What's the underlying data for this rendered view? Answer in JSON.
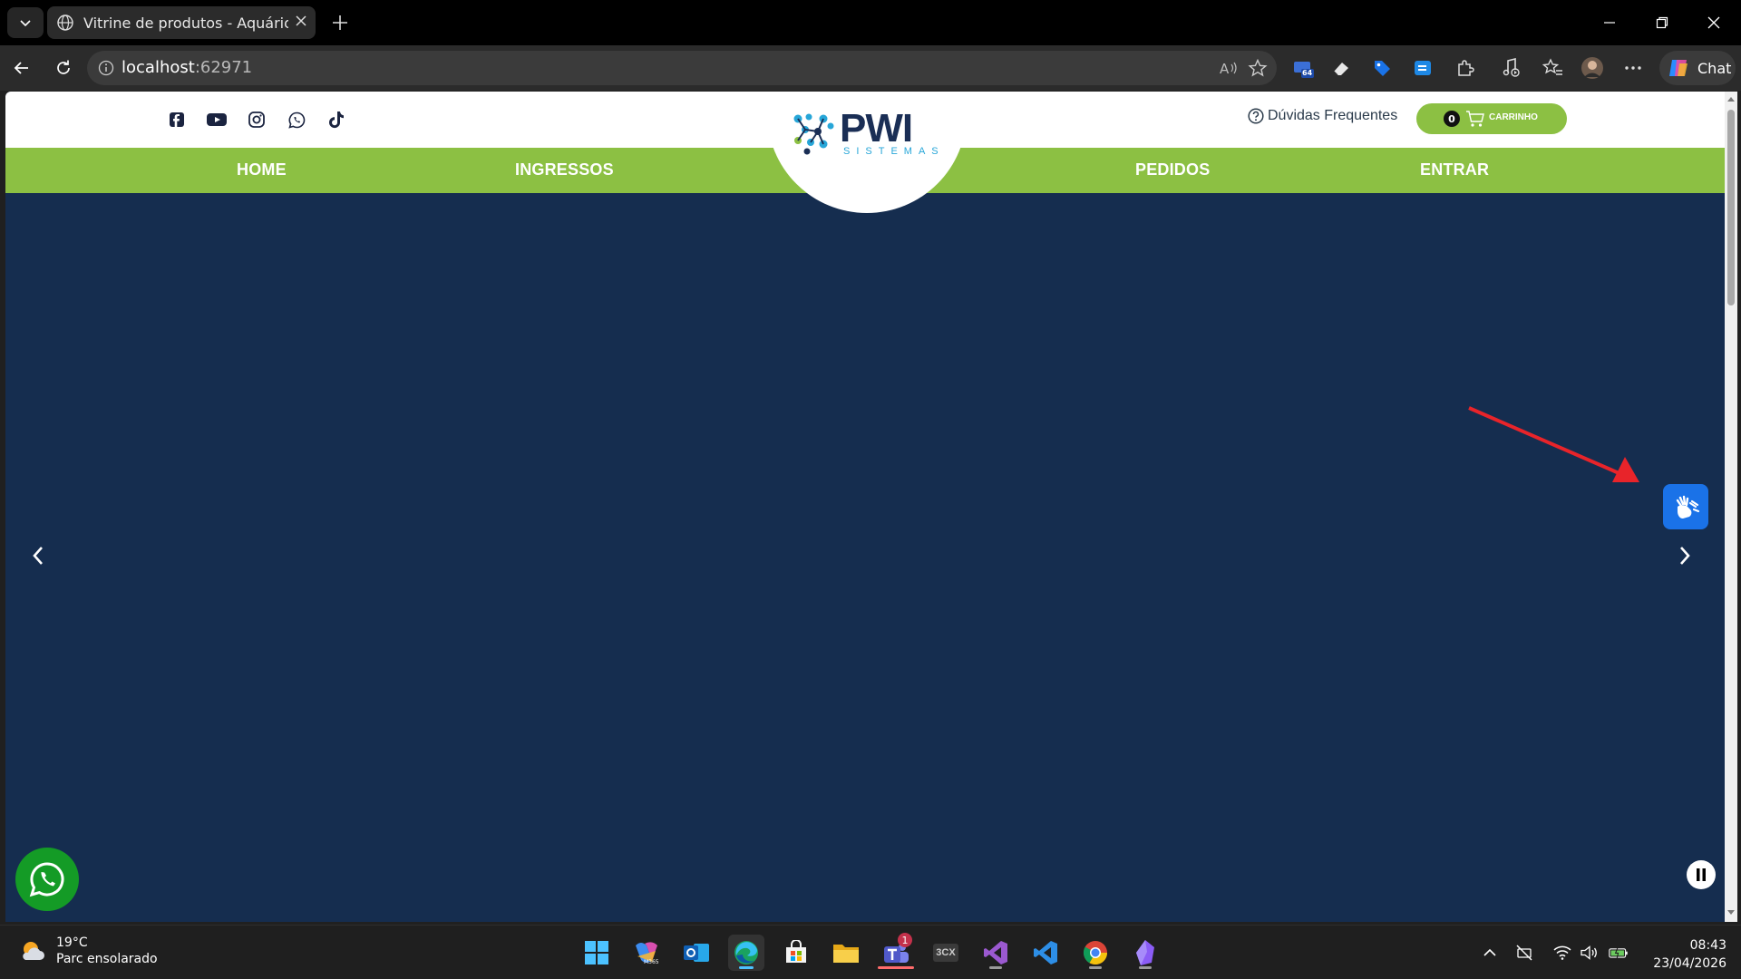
{
  "browser": {
    "tab_title": "Vitrine de produtos - Aquário de S",
    "address_host": "localhost",
    "address_port": ":62971",
    "copilot_label": "Chat",
    "extension_badge": "64"
  },
  "site": {
    "logo_text": "PWI",
    "logo_sub": "SISTEMAS",
    "nav": {
      "home": "HOME",
      "ingressos": "INGRESSOS",
      "pedidos": "PEDIDOS",
      "entrar": "ENTRAR"
    },
    "faq_label": "Dúvidas Frequentes",
    "cart": {
      "count": "0",
      "label": "CARRINHO"
    },
    "social_icons": [
      "facebook-icon",
      "youtube-icon",
      "instagram-icon",
      "whatsapp-icon",
      "tiktok-icon"
    ],
    "colors": {
      "nav_green": "#8cc043",
      "hero_navy": "#152d4f",
      "vlibras_blue": "#1a72e8",
      "whatsapp_green": "#149b26"
    }
  },
  "taskbar": {
    "weather_temp": "19°C",
    "weather_desc": "Parc ensolarado",
    "clock_time": "08:43",
    "clock_date": "23/04/2026",
    "teams_badge": "1",
    "threecx_label": "3CX"
  }
}
